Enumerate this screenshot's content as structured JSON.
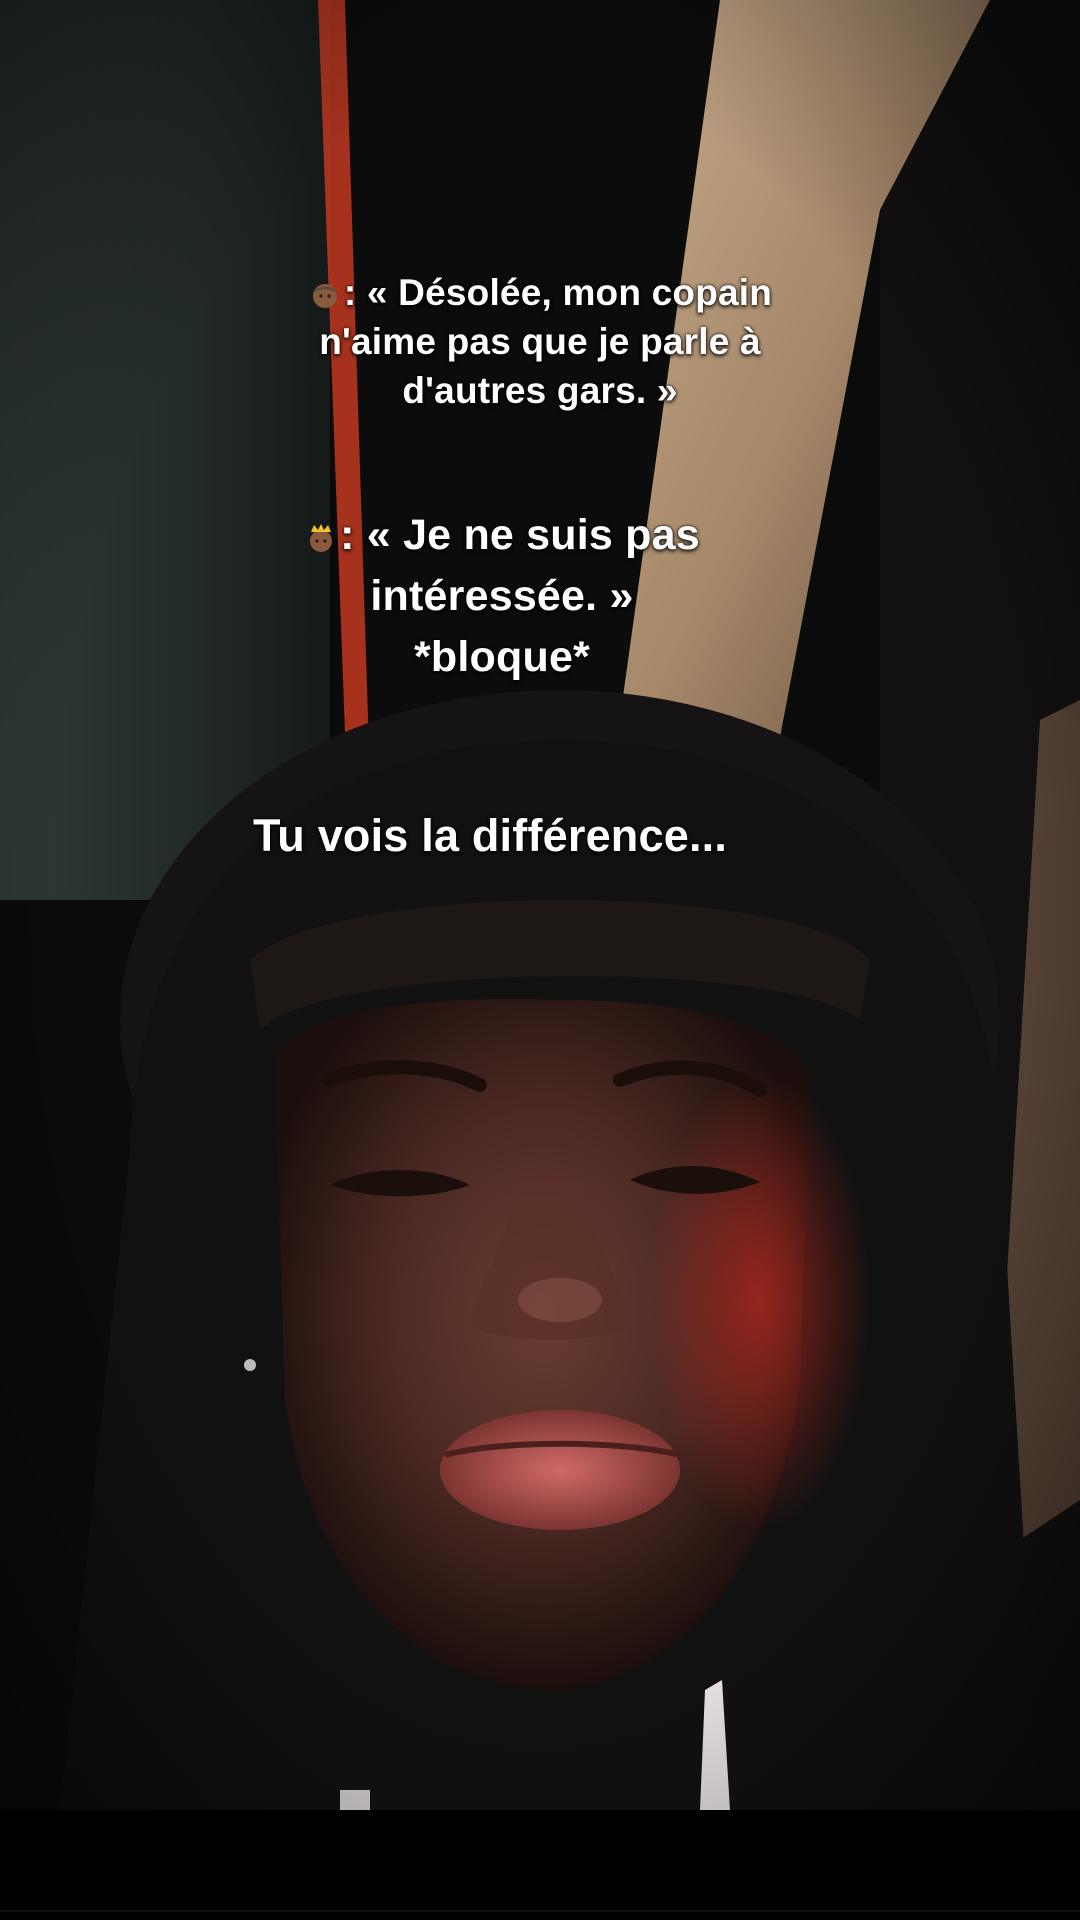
{
  "captions": {
    "line1": {
      "emoji": "woman-emoji",
      "text_lines": [
        ": « Désolée, mon copain",
        "n'aime pas que je parle à",
        "d'autres gars. »"
      ]
    },
    "line2": {
      "emoji": "princess-emoji",
      "text_lines": [
        ": « Je ne suis pas",
        "intéressée. »",
        "*bloque*"
      ]
    },
    "line3": {
      "text": "Tu vois la différence..."
    }
  },
  "colors": {
    "caption_text": "#ffffff",
    "bottom_bar": "#000000",
    "wall_red_stripe": "#c23a22",
    "wall_beige": "#b89a7c"
  }
}
